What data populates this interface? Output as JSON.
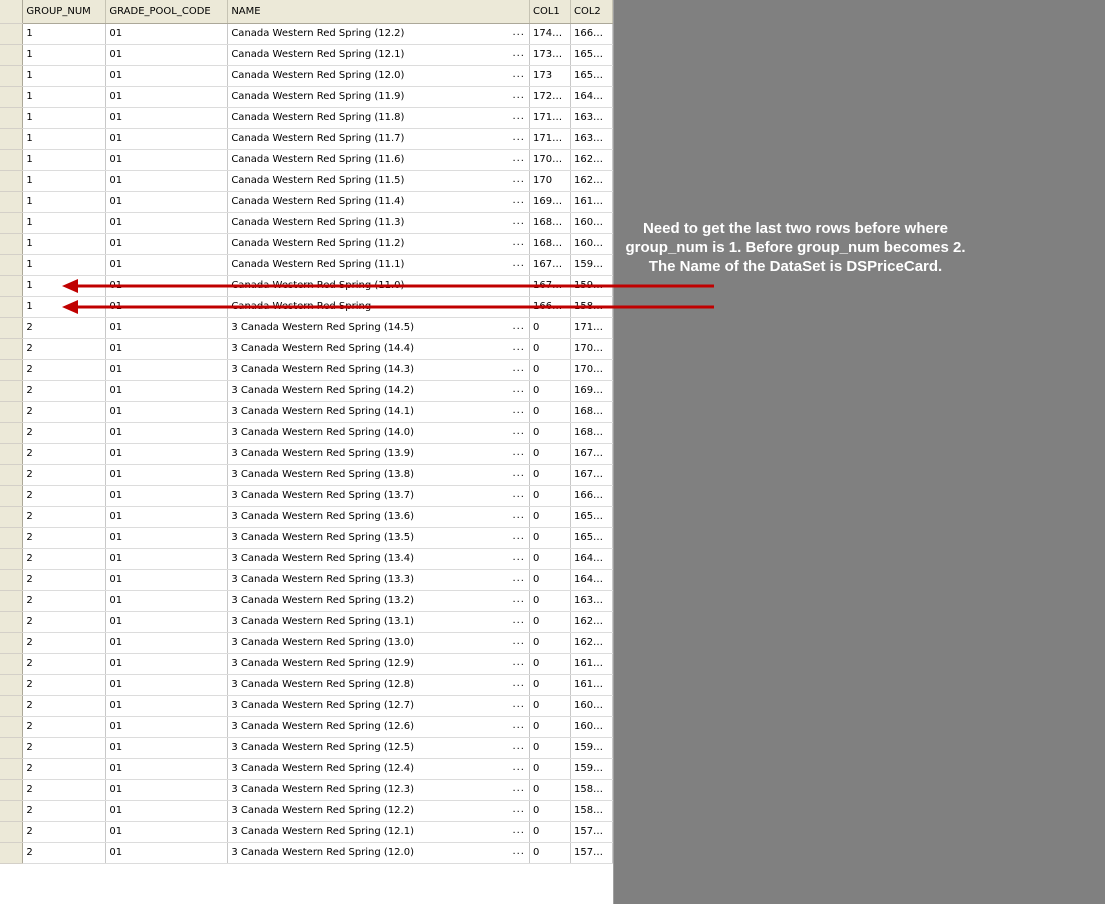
{
  "columns": [
    "GROUP_NUM",
    "GRADE_POOL_CODE",
    "NAME",
    "COL1",
    "COL2"
  ],
  "rows": [
    [
      "1",
      "01",
      "Canada Western Red Spring (12.2)",
      "174…",
      "166…"
    ],
    [
      "1",
      "01",
      "Canada Western Red Spring (12.1)",
      "173…",
      "165…"
    ],
    [
      "1",
      "01",
      "Canada Western Red Spring (12.0)",
      "173",
      "165…"
    ],
    [
      "1",
      "01",
      "Canada Western Red Spring (11.9)",
      "172…",
      "164…"
    ],
    [
      "1",
      "01",
      "Canada Western Red Spring (11.8)",
      "171…",
      "163…"
    ],
    [
      "1",
      "01",
      "Canada Western Red Spring (11.7)",
      "171…",
      "163…"
    ],
    [
      "1",
      "01",
      "Canada Western Red Spring (11.6)",
      "170…",
      "162…"
    ],
    [
      "1",
      "01",
      "Canada Western Red Spring (11.5)",
      "170",
      "162…"
    ],
    [
      "1",
      "01",
      "Canada Western Red Spring (11.4)",
      "169…",
      "161…"
    ],
    [
      "1",
      "01",
      "Canada Western Red Spring (11.3)",
      "168…",
      "160…"
    ],
    [
      "1",
      "01",
      "Canada Western Red Spring (11.2)",
      "168…",
      "160…"
    ],
    [
      "1",
      "01",
      "Canada Western Red Spring (11.1)",
      "167…",
      "159…"
    ],
    [
      "1",
      "01",
      "Canada Western Red Spring (11.0)",
      "167…",
      "159…"
    ],
    [
      "1",
      "01",
      "Canada Western Red Spring",
      "166…",
      "158…"
    ],
    [
      "2",
      "01",
      "3 Canada Western Red Spring (14.5)",
      "0",
      "171…"
    ],
    [
      "2",
      "01",
      "3 Canada Western Red Spring (14.4)",
      "0",
      "170…"
    ],
    [
      "2",
      "01",
      "3 Canada Western Red Spring (14.3)",
      "0",
      "170…"
    ],
    [
      "2",
      "01",
      "3 Canada Western Red Spring (14.2)",
      "0",
      "169…"
    ],
    [
      "2",
      "01",
      "3 Canada Western Red Spring (14.1)",
      "0",
      "168…"
    ],
    [
      "2",
      "01",
      "3 Canada Western Red Spring (14.0)",
      "0",
      "168…"
    ],
    [
      "2",
      "01",
      "3 Canada Western Red Spring (13.9)",
      "0",
      "167…"
    ],
    [
      "2",
      "01",
      "3 Canada Western Red Spring (13.8)",
      "0",
      "167…"
    ],
    [
      "2",
      "01",
      "3 Canada Western Red Spring (13.7)",
      "0",
      "166…"
    ],
    [
      "2",
      "01",
      "3 Canada Western Red Spring (13.6)",
      "0",
      "165…"
    ],
    [
      "2",
      "01",
      "3 Canada Western Red Spring (13.5)",
      "0",
      "165…"
    ],
    [
      "2",
      "01",
      "3 Canada Western Red Spring (13.4)",
      "0",
      "164…"
    ],
    [
      "2",
      "01",
      "3 Canada Western Red Spring (13.3)",
      "0",
      "164…"
    ],
    [
      "2",
      "01",
      "3 Canada Western Red Spring (13.2)",
      "0",
      "163…"
    ],
    [
      "2",
      "01",
      "3 Canada Western Red Spring (13.1)",
      "0",
      "162…"
    ],
    [
      "2",
      "01",
      "3 Canada Western Red Spring (13.0)",
      "0",
      "162…"
    ],
    [
      "2",
      "01",
      "3 Canada Western Red Spring (12.9)",
      "0",
      "161…"
    ],
    [
      "2",
      "01",
      "3 Canada Western Red Spring (12.8)",
      "0",
      "161…"
    ],
    [
      "2",
      "01",
      "3 Canada Western Red Spring (12.7)",
      "0",
      "160…"
    ],
    [
      "2",
      "01",
      "3 Canada Western Red Spring (12.6)",
      "0",
      "160…"
    ],
    [
      "2",
      "01",
      "3 Canada Western Red Spring (12.5)",
      "0",
      "159…"
    ],
    [
      "2",
      "01",
      "3 Canada Western Red Spring (12.4)",
      "0",
      "159…"
    ],
    [
      "2",
      "01",
      "3 Canada Western Red Spring (12.3)",
      "0",
      "158…"
    ],
    [
      "2",
      "01",
      "3 Canada Western Red Spring (12.2)",
      "0",
      "158…"
    ],
    [
      "2",
      "01",
      "3 Canada Western Red Spring (12.1)",
      "0",
      "157…"
    ],
    [
      "2",
      "01",
      "3 Canada Western Red Spring (12.0)",
      "0",
      "157…"
    ]
  ],
  "name_ellipsis": "...",
  "annotation": {
    "text": "Need to get the last two rows before where group_num is 1. Before group_num becomes 2. The Name of the DataSet is DSPriceCard.",
    "arrow_color": "#c00000",
    "pointed_rows": [
      12,
      13
    ]
  },
  "colors": {
    "background": "#808080",
    "grid_header": "#ece9d8",
    "annotation_text": "#ffffff"
  }
}
